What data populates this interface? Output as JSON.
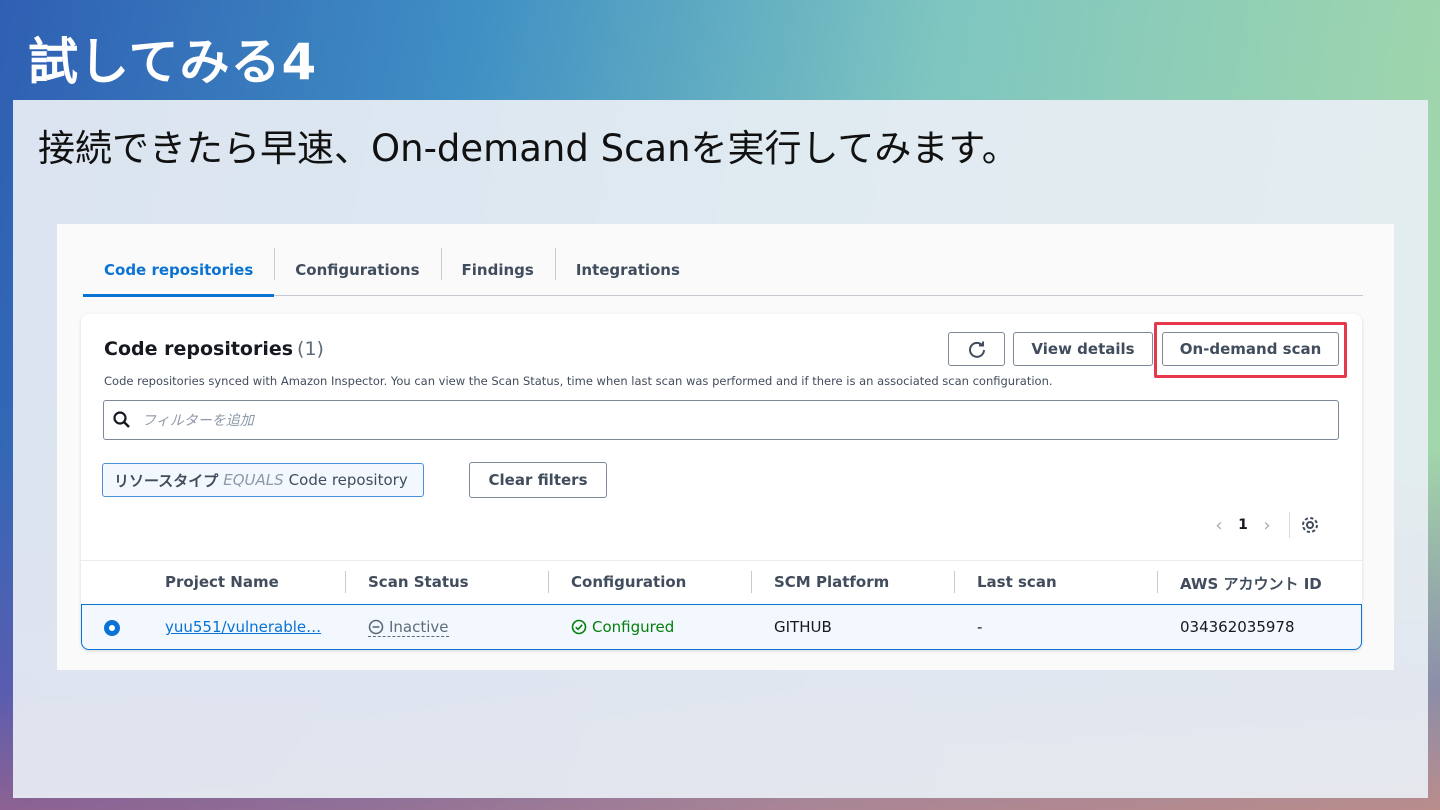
{
  "slide": {
    "title": "試してみる4",
    "subtitle": "接続できたら早速、On-demand Scanを実行してみます。"
  },
  "tabs": [
    {
      "label": "Code repositories",
      "active": true
    },
    {
      "label": "Configurations",
      "active": false
    },
    {
      "label": "Findings",
      "active": false
    },
    {
      "label": "Integrations",
      "active": false
    }
  ],
  "container": {
    "title": "Code repositories",
    "count": "(1)",
    "description": "Code repositories synced with Amazon Inspector. You can view the Scan Status, time when last scan was performed and if there is an associated scan configuration.",
    "view_details_label": "View details",
    "on_demand_scan_label": "On-demand scan"
  },
  "search": {
    "placeholder": "フィルターを追加"
  },
  "filter_token": {
    "key": "リソースタイプ",
    "operator": "EQUALS",
    "value": "Code repository"
  },
  "clear_filters_label": "Clear filters",
  "pagination": {
    "current_page": "1"
  },
  "table": {
    "columns": [
      "Project Name",
      "Scan Status",
      "Configuration",
      "SCM Platform",
      "Last scan",
      "AWS アカウント ID"
    ],
    "rows": [
      {
        "project_name": "yuu551/vulnerable…",
        "scan_status": "Inactive",
        "configuration": "Configured",
        "scm_platform": "GITHUB",
        "last_scan": "-",
        "account_id": "034362035978"
      }
    ]
  },
  "colors": {
    "accent": "#0972d3",
    "highlight": "#e5384a",
    "success": "#037f0c"
  }
}
